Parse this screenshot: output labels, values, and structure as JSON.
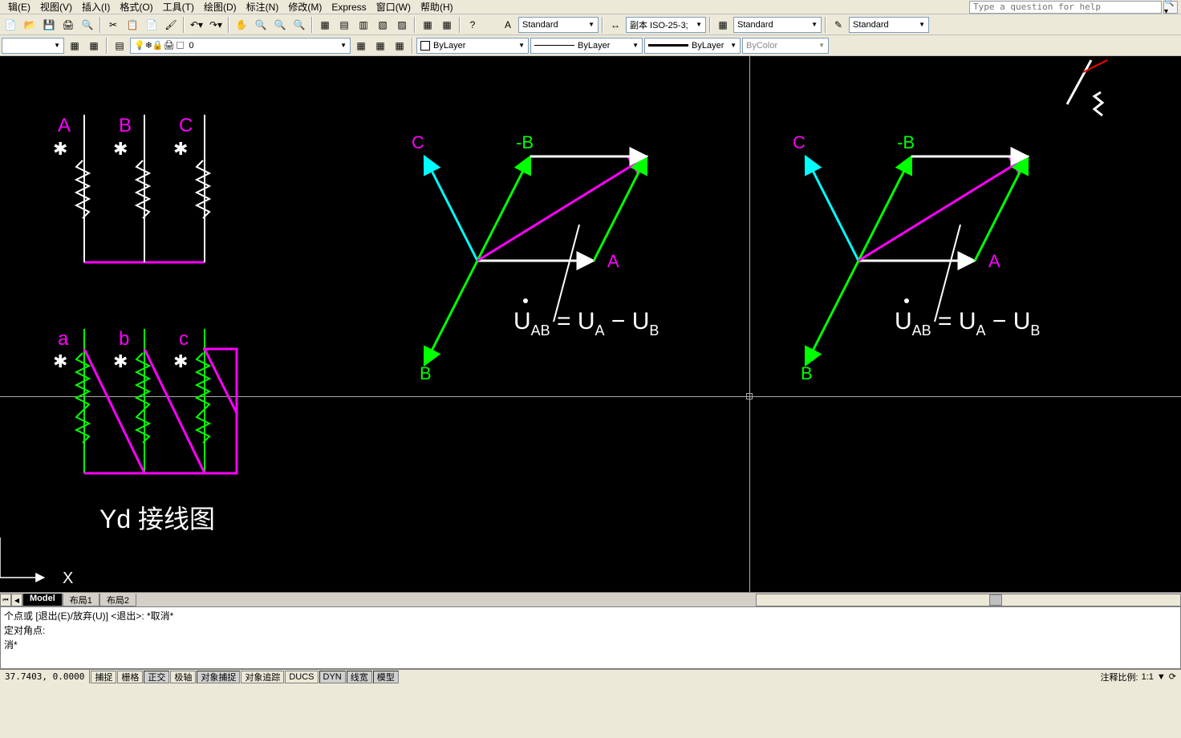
{
  "menu": {
    "items": [
      "辑(E)",
      "视图(V)",
      "插入(I)",
      "格式(O)",
      "工具(T)",
      "绘图(D)",
      "标注(N)",
      "修改(M)",
      "Express",
      "窗口(W)",
      "帮助(H)"
    ],
    "help_placeholder": "Type a question for help"
  },
  "toolbar1": {
    "style1": "Standard",
    "style2": "副本 ISO-25-3;",
    "style3": "Standard",
    "style4": "Standard"
  },
  "toolbar2": {
    "layer": "0",
    "linetype": "ByLayer",
    "lineweight": "ByLayer",
    "lineweight2": "ByLayer",
    "color": "ByColor"
  },
  "tabs": {
    "active": "Model",
    "items": [
      "Model",
      "布局1",
      "布局2"
    ]
  },
  "cmd": {
    "line1": "个点或 [退出(E)/放弃(U)] <退出>:  *取消*",
    "line2": "定对角点:",
    "line3": "消*"
  },
  "status": {
    "coords": "37.7403, 0.0000",
    "btns": [
      "捕捉",
      "栅格",
      "正交",
      "极轴",
      "对象捕捉",
      "对象追踪",
      "DUCS",
      "DYN",
      "线宽",
      "模型"
    ],
    "scale_label": "注释比例:",
    "scale_value": "1:1"
  },
  "drawing": {
    "labels_upper": {
      "A": "A",
      "B": "B",
      "C": "C"
    },
    "labels_lower": {
      "a": "a",
      "b": "b",
      "c": "c"
    },
    "title": "Yd 接线图",
    "axis_x": "X",
    "vec_A": "A",
    "vec_B": "B",
    "vec_C": "C",
    "vec_negB": "-B",
    "eq": "U",
    "eq_AB": "AB",
    "eq_A": "A",
    "eq_B": "B"
  }
}
